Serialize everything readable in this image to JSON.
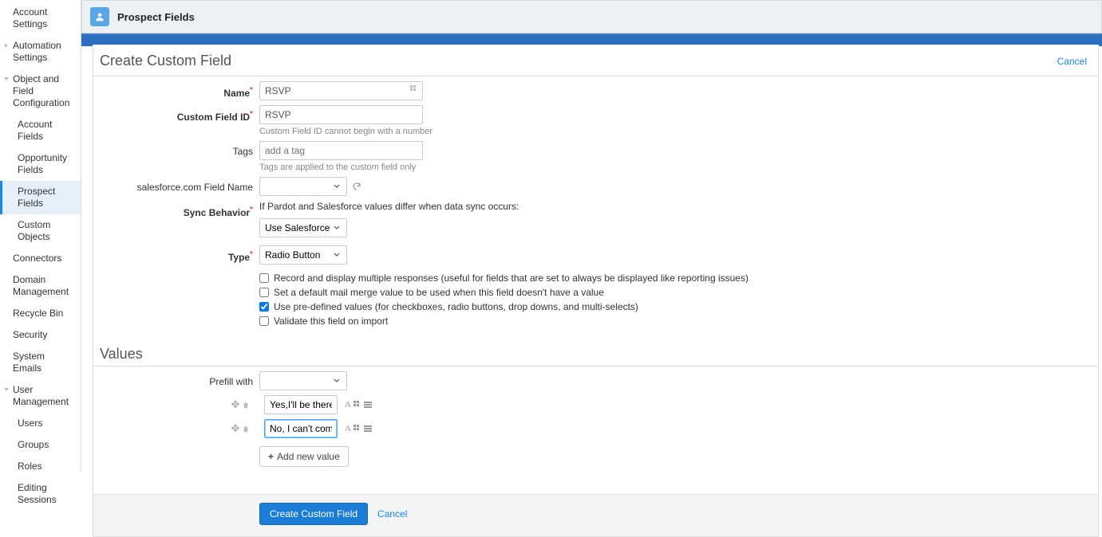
{
  "sidebar": {
    "items": [
      {
        "label": "Account Settings",
        "kind": "top"
      },
      {
        "label": "Automation Settings",
        "kind": "top-caret"
      },
      {
        "label": "Object and Field Configuration",
        "kind": "top-caret-open"
      },
      {
        "label": "Account Fields",
        "kind": "child"
      },
      {
        "label": "Opportunity Fields",
        "kind": "child"
      },
      {
        "label": "Prospect Fields",
        "kind": "child-active"
      },
      {
        "label": "Custom Objects",
        "kind": "child"
      },
      {
        "label": "Connectors",
        "kind": "top"
      },
      {
        "label": "Domain Management",
        "kind": "top"
      },
      {
        "label": "Recycle Bin",
        "kind": "top"
      },
      {
        "label": "Security",
        "kind": "top"
      },
      {
        "label": "System Emails",
        "kind": "top"
      },
      {
        "label": "User Management",
        "kind": "top-caret-open"
      },
      {
        "label": "Users",
        "kind": "child"
      },
      {
        "label": "Groups",
        "kind": "child"
      },
      {
        "label": "Roles",
        "kind": "child"
      },
      {
        "label": "Editing Sessions",
        "kind": "child"
      }
    ]
  },
  "header": {
    "title": "Prospect Fields"
  },
  "form": {
    "heading": "Create Custom Field",
    "cancel": "Cancel",
    "labels": {
      "name": "Name",
      "custom_field_id": "Custom Field ID",
      "tags": "Tags",
      "sf_field": "salesforce.com Field Name",
      "sync": "Sync Behavior",
      "type": "Type",
      "prefill": "Prefill with"
    },
    "values": {
      "name": "RSVP",
      "custom_field_id": "RSVP",
      "tags_placeholder": "add a tag",
      "sf_field": "",
      "sync_selected": "Use Salesforce's value",
      "type_selected": "Radio Button"
    },
    "help": {
      "custom_field_id": "Custom Field ID cannot begin with a number",
      "tags": "Tags are applied to the custom field only",
      "sync_intro": "If Pardot and Salesforce values differ when data sync occurs:"
    },
    "checkboxes": {
      "record_multi": "Record and display multiple responses (useful for fields that are set to always be displayed like reporting issues)",
      "default_mail_merge": "Set a default mail merge value to be used when this field doesn't have a value",
      "predefined": "Use pre-defined values (for checkboxes, radio buttons, drop downs, and multi-selects)",
      "validate_import": "Validate this field on import"
    },
    "checkbox_state": {
      "record_multi": false,
      "default_mail_merge": false,
      "predefined": true,
      "validate_import": false
    },
    "values_section": {
      "heading": "Values",
      "rows": [
        {
          "value": "Yes,I'll be there!"
        },
        {
          "value": "No, I can't come."
        }
      ],
      "add_new": "Add new value"
    },
    "footer": {
      "submit": "Create Custom Field",
      "cancel": "Cancel"
    }
  }
}
